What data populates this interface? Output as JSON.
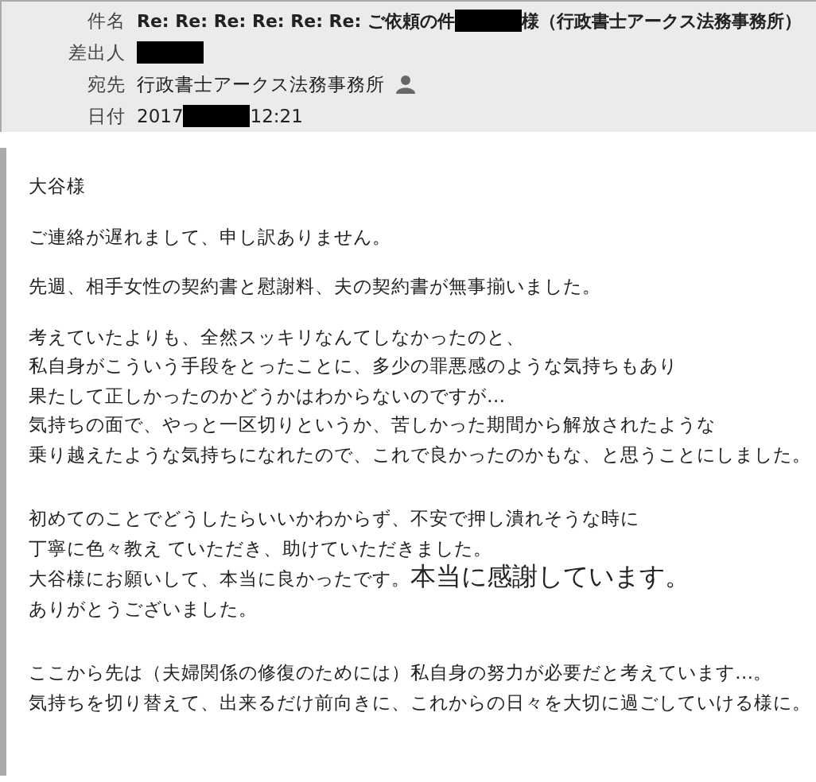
{
  "header": [
    {
      "label": "件名",
      "kind": "subject",
      "segments": [
        {
          "kind": "text",
          "text": "Re: Re: Re: Re: Re: Re: ご依頼の件"
        },
        {
          "kind": "redacted"
        },
        {
          "kind": "text",
          "text": "様（行政書士アークス法務事務所）"
        }
      ]
    },
    {
      "label": "差出人",
      "kind": "sender",
      "segments": [
        {
          "kind": "redacted"
        }
      ]
    },
    {
      "label": "宛先",
      "kind": "recipient",
      "segments": [
        {
          "kind": "text",
          "text": "行政書士アークス法務事務所"
        }
      ],
      "contact_icon": true
    },
    {
      "label": "日付",
      "kind": "date",
      "segments": [
        {
          "kind": "text",
          "text": "2017"
        },
        {
          "kind": "redacted"
        },
        {
          "kind": "text",
          "text": "12:21"
        }
      ]
    }
  ],
  "body": [
    {
      "lines": [
        [
          {
            "kind": "text",
            "text": "大谷様"
          }
        ]
      ]
    },
    {
      "lines": [
        [
          {
            "kind": "text",
            "text": "ご連絡が遅れまして、申し訳ありません。"
          }
        ]
      ]
    },
    {
      "lines": [
        [
          {
            "kind": "text",
            "text": "先週、相手女性の契約書と慰謝料、夫の契約書が無事揃いました。"
          }
        ]
      ]
    },
    {
      "lines": [
        [
          {
            "kind": "text",
            "text": "考えていたよりも、全然スッキリなんてしなかったのと、"
          }
        ],
        [
          {
            "kind": "text",
            "text": "私自身がこういう手段をとったことに、多少の罪悪感のような気持ちもあり"
          }
        ],
        [
          {
            "kind": "text",
            "text": "果たして正しかったのかどうかはわからないのですが…"
          }
        ],
        [
          {
            "kind": "text",
            "text": "気持ちの面で、やっと一区切りというか、苦しかった期間から解放されたような"
          }
        ],
        [
          {
            "kind": "text",
            "text": "乗り越えたような気持ちになれたので、これで良かったのかもな、と思うことにしました。"
          }
        ]
      ]
    },
    {
      "lines": [
        [
          {
            "kind": "text",
            "text": "初めてのことでどうしたらいいかわからず、不安で押し潰れそうな時に"
          }
        ],
        [
          {
            "kind": "text",
            "text": "丁寧に色々教え ていただき、助けていただきました。"
          }
        ],
        [
          {
            "kind": "text",
            "text": "大谷様にお願いして、本当に良かったです。"
          },
          {
            "kind": "large",
            "text": "本当に感謝しています。"
          }
        ],
        [
          {
            "kind": "text",
            "text": "ありがとうございました。"
          }
        ]
      ]
    },
    {
      "lines": [
        [
          {
            "kind": "text",
            "text": "ここから先は（夫婦関係の修復のためには）私自身の努力が必要だと考えています…。"
          }
        ],
        [
          {
            "kind": "text",
            "text": "気持ちを切り替えて、出来るだけ前向きに、これからの日々を大切に過ごしていける様に。"
          }
        ]
      ]
    }
  ]
}
